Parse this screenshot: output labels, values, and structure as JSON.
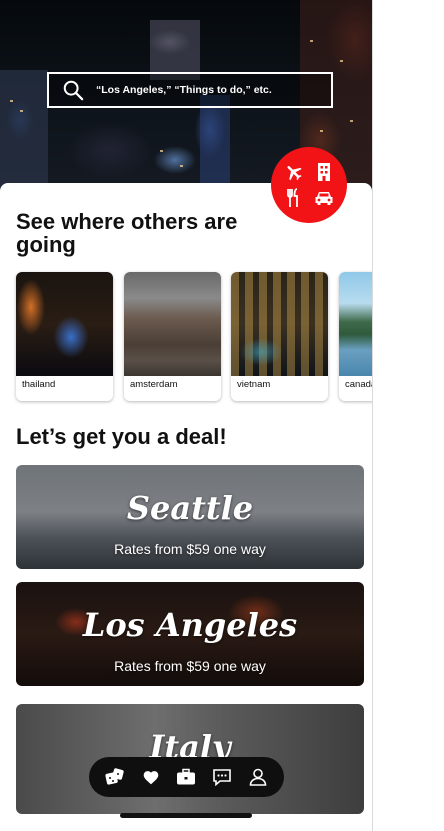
{
  "search": {
    "placeholder": "“Los Angeles,” “Things to do,” etc."
  },
  "fab": {
    "icons": [
      "plane-icon",
      "hotel-icon",
      "restaurant-icon",
      "car-icon"
    ],
    "color": "#f21317"
  },
  "destinations": {
    "title": "See where others are going",
    "items": [
      {
        "label": "thailand"
      },
      {
        "label": "amsterdam"
      },
      {
        "label": "vietnam"
      },
      {
        "label": "canada"
      }
    ]
  },
  "deals": {
    "title": "Let’s get you a deal!",
    "items": [
      {
        "city": "Seattle",
        "rate": "Rates from $59 one way"
      },
      {
        "city": "Los Angeles",
        "rate": "Rates from $59 one way"
      },
      {
        "city": "Italy",
        "rate": ""
      }
    ]
  },
  "nav": {
    "icons": [
      "dice-icon",
      "heart-icon",
      "briefcase-icon",
      "chat-icon",
      "profile-icon"
    ]
  }
}
